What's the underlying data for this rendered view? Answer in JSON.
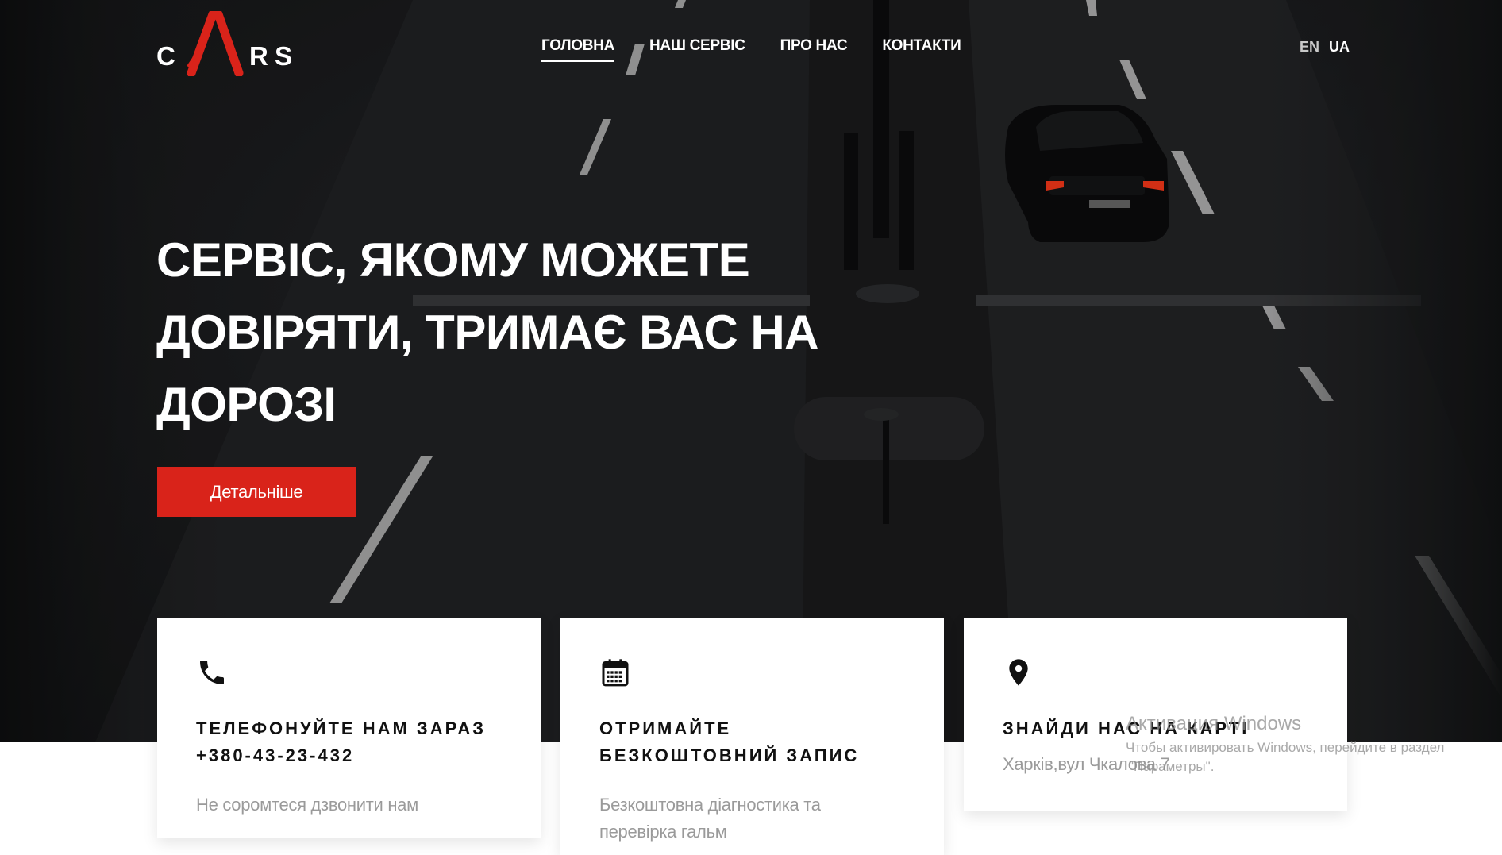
{
  "header": {
    "logo": {
      "letters": [
        "C",
        "A",
        "R",
        "S"
      ]
    },
    "nav": [
      {
        "label": "ГОЛОВНА",
        "active": true
      },
      {
        "label": "НАШ СЕРВІС",
        "active": false
      },
      {
        "label": "ПРО НАС",
        "active": false
      },
      {
        "label": "КОНТАКТИ",
        "active": false
      }
    ],
    "languages": [
      {
        "code": "EN",
        "active": false
      },
      {
        "code": "UA",
        "active": true
      }
    ]
  },
  "hero": {
    "headline_lines": [
      "СЕРВІС, ЯКОМУ МОЖЕТЕ",
      "ДОВІРЯТИ, ТРИМАЄ ВАС НА",
      "ДОРОЗІ"
    ],
    "cta_label": "Детальніше"
  },
  "cards": [
    {
      "icon": "phone-icon",
      "title_lines": [
        "ТЕЛЕФОНУЙТЕ НАМ ЗАРАЗ",
        "+380-43-23-432"
      ],
      "text_lines": [
        "Не соромтеся дзвонити нам"
      ]
    },
    {
      "icon": "calendar-icon",
      "title_lines": [
        "ОТРИМАЙТЕ",
        "БЕЗКОШТОВНИЙ ЗАПИС"
      ],
      "text_lines": [
        "Безкоштовна діагностика та",
        "перевірка гальм"
      ]
    },
    {
      "icon": "map-pin-icon",
      "title_lines": [
        "ЗНАЙДИ НАС НА КАРТІ"
      ],
      "text_lines": [
        "Харків,вул Чкалова 7"
      ]
    }
  ],
  "watermark": {
    "title": "Активация Windows",
    "subtitle_lines": [
      "Чтобы активировать Windows, перейдите в раздел",
      "\"Параметры\"."
    ]
  },
  "colors": {
    "accent": "#d9231a",
    "hero_dark": "#1c1d1f",
    "card_title": "#111111",
    "card_text": "#9a9a9a"
  }
}
